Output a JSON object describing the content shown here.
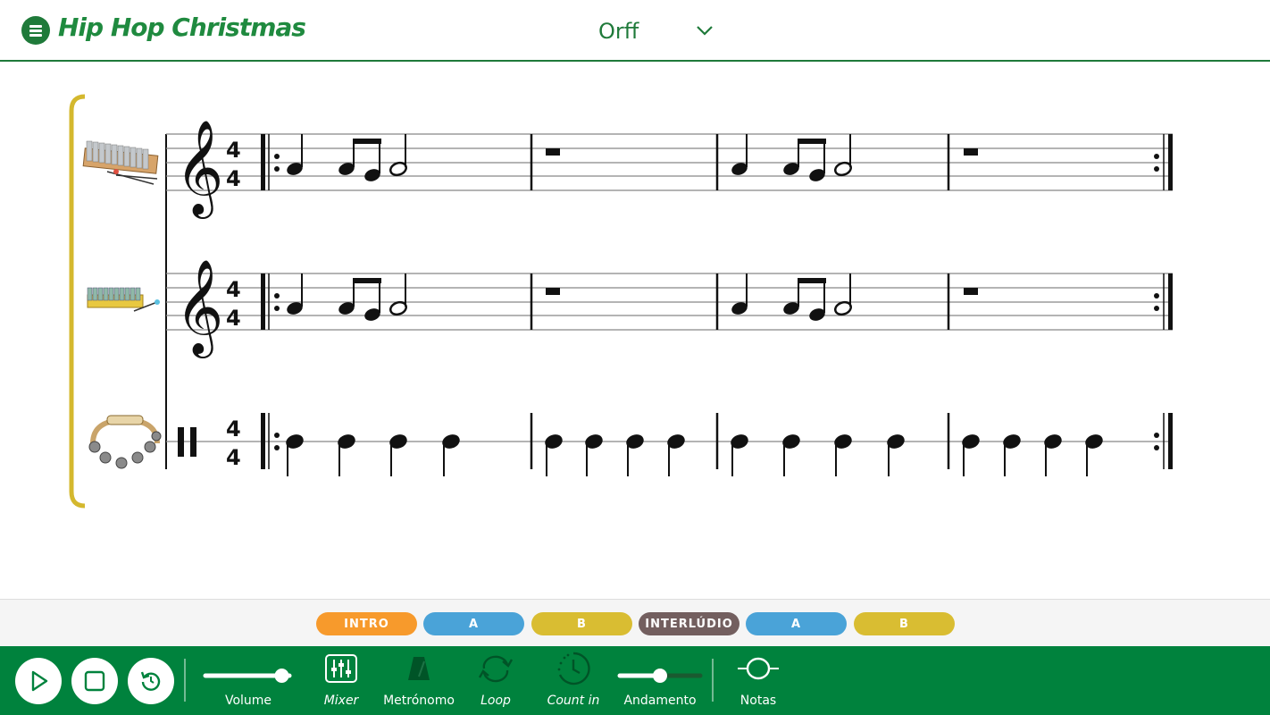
{
  "header": {
    "title": "Hip Hop Christmas",
    "arrangement_label": "Orff",
    "accent": "#1f7a3a"
  },
  "score": {
    "staves": [
      {
        "instrument": "glockenspiel",
        "clef": "treble",
        "time_top": "4",
        "time_bottom": "4"
      },
      {
        "instrument": "xylophone",
        "clef": "treble",
        "time_top": "4",
        "time_bottom": "4"
      },
      {
        "instrument": "sleigh bells",
        "clef": "percussion",
        "time_top": "4",
        "time_bottom": "4"
      }
    ],
    "bracket_color": "#d4b82e"
  },
  "parts": [
    {
      "label": "INTRO",
      "color": "#f79a2c"
    },
    {
      "label": "A",
      "color": "#4aa3d8"
    },
    {
      "label": "B",
      "color": "#d9bd32"
    },
    {
      "label": "INTERLÚDIO",
      "color": "#735f5f"
    },
    {
      "label": "A",
      "color": "#4aa3d8"
    },
    {
      "label": "B",
      "color": "#d9bd32"
    }
  ],
  "toolbar": {
    "background": "#00823d",
    "volume_label": "Volume",
    "volume_level": 0.95,
    "mixer_label": "Mixer",
    "metronome_label": "Metrónomo",
    "loop_label": "Loop",
    "countin_label": "Count in",
    "tempo_label": "Andamento",
    "tempo_level": 0.5,
    "notes_label": "Notas"
  }
}
